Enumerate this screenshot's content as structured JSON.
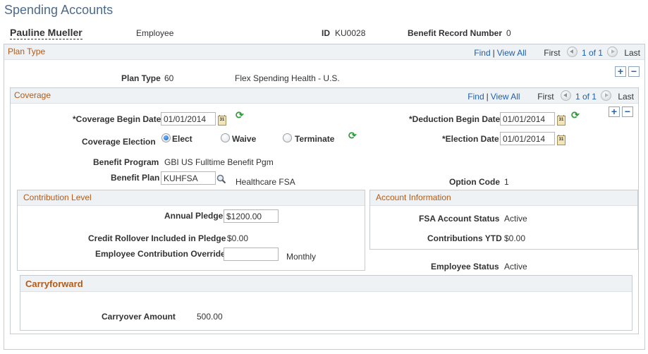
{
  "page": {
    "title": "Spending Accounts"
  },
  "employee": {
    "name": "Pauline Mueller",
    "type": "Employee",
    "id_label": "ID",
    "id_value": "KU0028",
    "benefit_record_label": "Benefit Record Number",
    "benefit_record_value": "0"
  },
  "plan_type_section": {
    "title": "Plan Type",
    "nav": {
      "find": "Find",
      "sep": "|",
      "view_all": "View All",
      "first": "First",
      "range": "1 of 1",
      "last": "Last"
    },
    "plan_type_label": "Plan Type",
    "plan_type_value": "60",
    "plan_type_desc": "Flex Spending Health - U.S.",
    "add_label": "+",
    "remove_label": "−"
  },
  "coverage_section": {
    "title": "Coverage",
    "nav": {
      "find": "Find",
      "sep": "|",
      "view_all": "View All",
      "first": "First",
      "range": "1 of 1",
      "last": "Last"
    },
    "add_label": "+",
    "remove_label": "−",
    "coverage_begin_label": "*Coverage Begin Date",
    "coverage_begin_value": "01/01/2014",
    "deduction_begin_label": "*Deduction Begin Date",
    "deduction_begin_value": "01/01/2014",
    "coverage_election_label": "Coverage Election",
    "election_options": [
      {
        "label": "Elect",
        "selected": true
      },
      {
        "label": "Waive",
        "selected": false
      },
      {
        "label": "Terminate",
        "selected": false
      }
    ],
    "election_date_label": "*Election Date",
    "election_date_value": "01/01/2014",
    "benefit_program_label": "Benefit Program",
    "benefit_program_value": "GBI US Fulltime Benefit Pgm",
    "benefit_plan_label": "Benefit Plan",
    "benefit_plan_value": "KUHFSA",
    "benefit_plan_desc": "Healthcare FSA",
    "option_code_label": "Option Code",
    "option_code_value": "1",
    "calendar_glyph": "31",
    "refresh_glyph": "⟳",
    "employee_status_label": "Employee Status",
    "employee_status_value": "Active"
  },
  "contribution_level": {
    "title": "Contribution Level",
    "annual_pledge_label": "Annual Pledge",
    "annual_pledge_value": "$1200.00",
    "credit_rollover_label": "Credit Rollover Included in Pledge",
    "credit_rollover_value": "$0.00",
    "override_label": "Employee Contribution Override",
    "override_value": "",
    "override_freq": "Monthly"
  },
  "account_information": {
    "title": "Account Information",
    "fsa_status_label": "FSA Account Status",
    "fsa_status_value": "Active",
    "contrib_ytd_label": "Contributions YTD",
    "contrib_ytd_value": "$0.00"
  },
  "carryforward": {
    "title": "Carryforward",
    "carryover_label": "Carryover Amount",
    "carryover_value": "500.00"
  }
}
